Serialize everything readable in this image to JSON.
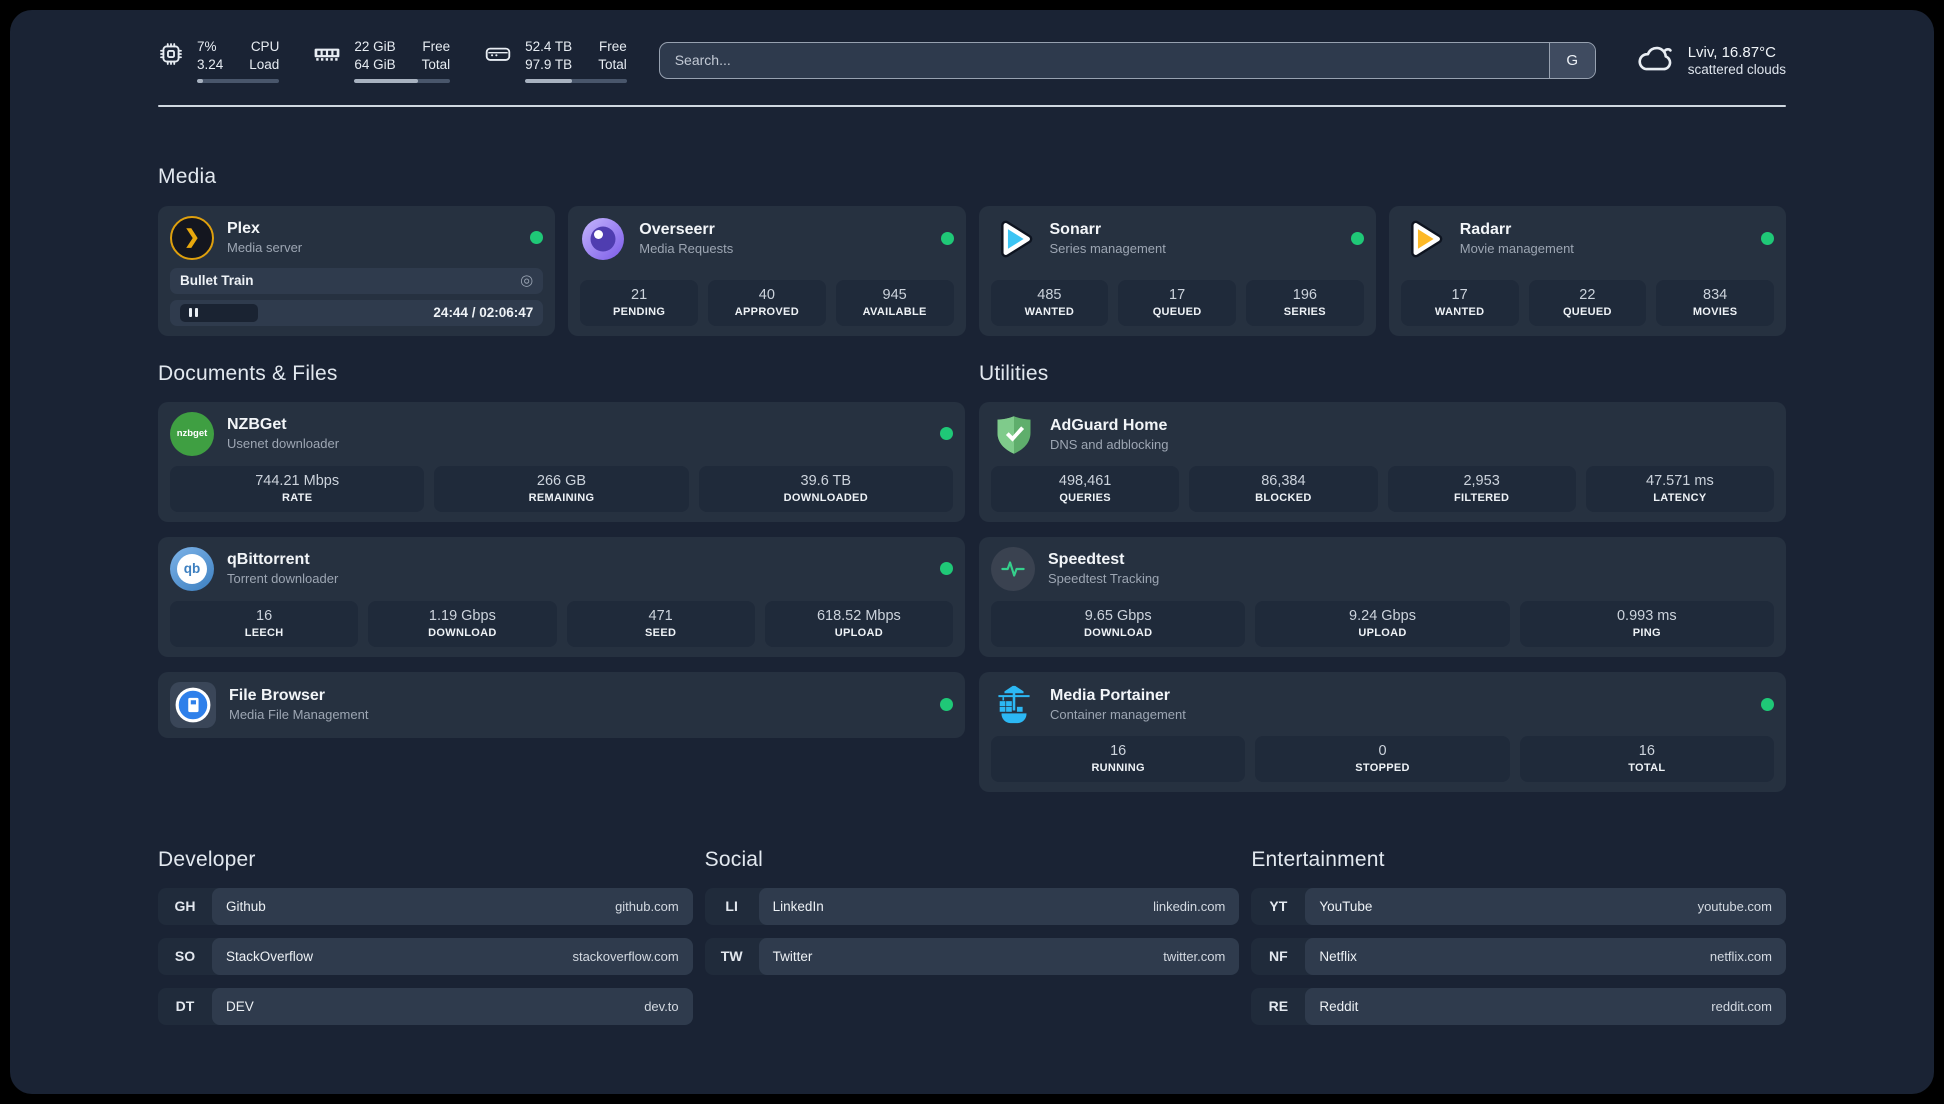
{
  "colors": {
    "accent_green": "#1fc877",
    "plex_amber": "#e5a00d",
    "sonarr_cyan": "#3cc5f4",
    "radarr_yellow": "#fdb927",
    "portainer_blue": "#2cb8f4"
  },
  "topbar": {
    "cpu": {
      "values": [
        "7%",
        "3.24"
      ],
      "labels": [
        "CPU",
        "Load"
      ],
      "percent": 7
    },
    "memory": {
      "values": [
        "22 GiB",
        "64 GiB"
      ],
      "labels": [
        "Free",
        "Total"
      ],
      "percent": 66
    },
    "disk": {
      "values": [
        "52.4 TB",
        "97.9 TB"
      ],
      "labels": [
        "Free",
        "Total"
      ],
      "percent": 46
    },
    "search": {
      "placeholder": "Search...",
      "provider_button": "G"
    },
    "weather": {
      "location": "Lviv, 16.87°C",
      "condition": "scattered clouds"
    }
  },
  "media": {
    "heading": "Media",
    "cards": [
      {
        "title": "Plex",
        "subtitle": "Media server",
        "online": true,
        "now_playing": {
          "title": "Bullet Train",
          "state": "paused",
          "time": "24:44 / 02:06:47"
        }
      },
      {
        "title": "Overseerr",
        "subtitle": "Media Requests",
        "online": true,
        "stats": [
          {
            "value": "21",
            "label": "PENDING"
          },
          {
            "value": "40",
            "label": "APPROVED"
          },
          {
            "value": "945",
            "label": "AVAILABLE"
          }
        ]
      },
      {
        "title": "Sonarr",
        "subtitle": "Series management",
        "online": true,
        "stats": [
          {
            "value": "485",
            "label": "WANTED"
          },
          {
            "value": "17",
            "label": "QUEUED"
          },
          {
            "value": "196",
            "label": "SERIES"
          }
        ]
      },
      {
        "title": "Radarr",
        "subtitle": "Movie management",
        "online": true,
        "stats": [
          {
            "value": "17",
            "label": "WANTED"
          },
          {
            "value": "22",
            "label": "QUEUED"
          },
          {
            "value": "834",
            "label": "MOVIES"
          }
        ]
      }
    ]
  },
  "documents": {
    "heading": "Documents & Files",
    "cards": [
      {
        "title": "NZBGet",
        "subtitle": "Usenet downloader",
        "online": true,
        "stats": [
          {
            "value": "744.21 Mbps",
            "label": "RATE"
          },
          {
            "value": "266 GB",
            "label": "REMAINING"
          },
          {
            "value": "39.6 TB",
            "label": "DOWNLOADED"
          }
        ]
      },
      {
        "title": "qBittorrent",
        "subtitle": "Torrent downloader",
        "online": true,
        "stats": [
          {
            "value": "16",
            "label": "LEECH"
          },
          {
            "value": "1.19 Gbps",
            "label": "DOWNLOAD"
          },
          {
            "value": "471",
            "label": "SEED"
          },
          {
            "value": "618.52 Mbps",
            "label": "UPLOAD"
          }
        ]
      },
      {
        "title": "File Browser",
        "subtitle": "Media File Management",
        "online": true
      }
    ]
  },
  "utilities": {
    "heading": "Utilities",
    "cards": [
      {
        "title": "AdGuard Home",
        "subtitle": "DNS and adblocking",
        "online": false,
        "stats": [
          {
            "value": "498,461",
            "label": "QUERIES"
          },
          {
            "value": "86,384",
            "label": "BLOCKED"
          },
          {
            "value": "2,953",
            "label": "FILTERED"
          },
          {
            "value": "47.571 ms",
            "label": "LATENCY"
          }
        ]
      },
      {
        "title": "Speedtest",
        "subtitle": "Speedtest Tracking",
        "online": false,
        "stats": [
          {
            "value": "9.65 Gbps",
            "label": "DOWNLOAD"
          },
          {
            "value": "9.24 Gbps",
            "label": "UPLOAD"
          },
          {
            "value": "0.993 ms",
            "label": "PING"
          }
        ]
      },
      {
        "title": "Media Portainer",
        "subtitle": "Container management",
        "online": true,
        "stats": [
          {
            "value": "16",
            "label": "RUNNING"
          },
          {
            "value": "0",
            "label": "STOPPED"
          },
          {
            "value": "16",
            "label": "TOTAL"
          }
        ]
      }
    ]
  },
  "bookmarks": [
    {
      "heading": "Developer",
      "items": [
        {
          "abbr": "GH",
          "name": "Github",
          "url": "github.com"
        },
        {
          "abbr": "SO",
          "name": "StackOverflow",
          "url": "stackoverflow.com"
        },
        {
          "abbr": "DT",
          "name": "DEV",
          "url": "dev.to"
        }
      ]
    },
    {
      "heading": "Social",
      "items": [
        {
          "abbr": "LI",
          "name": "LinkedIn",
          "url": "linkedin.com"
        },
        {
          "abbr": "TW",
          "name": "Twitter",
          "url": "twitter.com"
        }
      ]
    },
    {
      "heading": "Entertainment",
      "items": [
        {
          "abbr": "YT",
          "name": "YouTube",
          "url": "youtube.com"
        },
        {
          "abbr": "NF",
          "name": "Netflix",
          "url": "netflix.com"
        },
        {
          "abbr": "RE",
          "name": "Reddit",
          "url": "reddit.com"
        }
      ]
    }
  ]
}
